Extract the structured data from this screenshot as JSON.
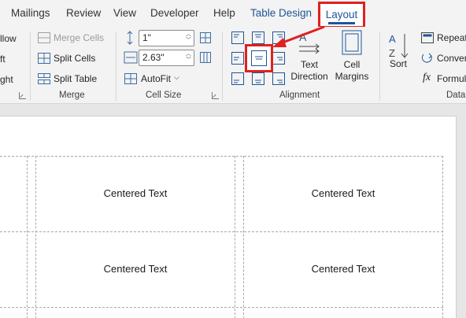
{
  "tabs": {
    "mailings": "Mailings",
    "review": "Review",
    "view": "View",
    "developer": "Developer",
    "help": "Help",
    "table_design": "Table Design",
    "layout": "Layout"
  },
  "ribbon": {
    "merge_group": {
      "partial_items": [
        "llow",
        "ft",
        "ght"
      ],
      "merge_cells": "Merge Cells",
      "split_cells": "Split Cells",
      "split_table": "Split Table",
      "label": "Merge"
    },
    "cell_size": {
      "height_value": "1\"",
      "width_value": "2.63\"",
      "autofit": "AutoFit",
      "label": "Cell Size"
    },
    "alignment": {
      "text_direction": "Text Direction",
      "cell_margins": "Cell Margins",
      "label": "Alignment"
    },
    "data": {
      "sort": "Sort",
      "repeat": "Repeat",
      "convert": "Conver",
      "formula": "Formul",
      "label": "Data"
    }
  },
  "document": {
    "cells": [
      "Centered Text",
      "Centered Text",
      "Centered Text",
      "Centered Text"
    ]
  },
  "colors": {
    "highlight": "#e02020",
    "accent": "#1f5596"
  }
}
